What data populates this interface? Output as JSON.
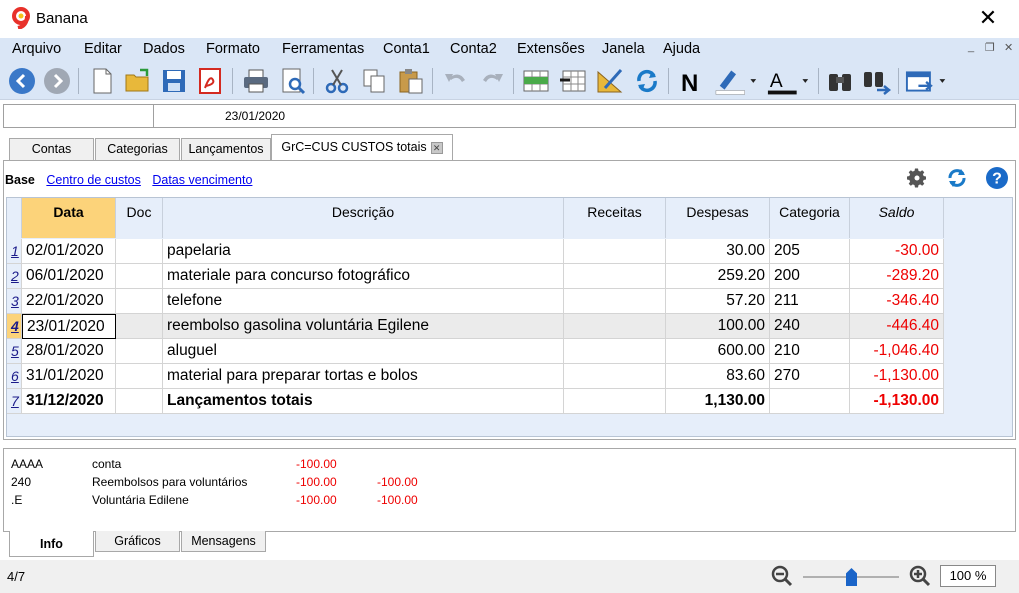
{
  "window": {
    "title": "Banana"
  },
  "menu": [
    "Arquivo",
    "Editar",
    "Dados",
    "Formato",
    "Ferramentas",
    "Conta1",
    "Conta2",
    "Extensões",
    "Janela",
    "Ajuda"
  ],
  "fieldbar": {
    "value": "23/01/2020"
  },
  "tabs": [
    "Contas",
    "Categorias",
    "Lançamentos",
    "GrC=CUS CUSTOS totais"
  ],
  "views": {
    "base": "Base",
    "cost_centers": "Centro de custos",
    "due_dates": "Datas vencimento"
  },
  "table": {
    "headers": {
      "date": "Data",
      "doc": "Doc",
      "description": "Descrição",
      "income": "Receitas",
      "expenses": "Despesas",
      "category": "Categoria",
      "balance": "Saldo"
    },
    "rows": [
      {
        "n": "1",
        "date": "02/01/2020",
        "doc": "",
        "description": "papelaria",
        "income": "",
        "expenses": "30.00",
        "category": "205",
        "balance": "-30.00"
      },
      {
        "n": "2",
        "date": "06/01/2020",
        "doc": "",
        "description": "materiale para concurso fotográfico",
        "income": "",
        "expenses": "259.20",
        "category": "200",
        "balance": "-289.20"
      },
      {
        "n": "3",
        "date": "22/01/2020",
        "doc": "",
        "description": "telefone",
        "income": "",
        "expenses": "57.20",
        "category": "211",
        "balance": "-346.40"
      },
      {
        "n": "4",
        "date": "23/01/2020",
        "doc": "",
        "description": "reembolso gasolina voluntária Egilene",
        "income": "",
        "expenses": "100.00",
        "category": "240",
        "balance": "-446.40"
      },
      {
        "n": "5",
        "date": "28/01/2020",
        "doc": "",
        "description": "aluguel",
        "income": "",
        "expenses": "600.00",
        "category": "210",
        "balance": "-1,046.40"
      },
      {
        "n": "6",
        "date": "31/01/2020",
        "doc": "",
        "description": "material para preparar tortas e bolos",
        "income": "",
        "expenses": "83.60",
        "category": "270",
        "balance": "-1,130.00"
      },
      {
        "n": "7",
        "date": "31/12/2020",
        "doc": "",
        "description": "Lançamentos totais",
        "income": "",
        "expenses": "1,130.00",
        "category": "",
        "balance": "-1,130.00"
      }
    ]
  },
  "info": [
    {
      "code": "AAAA",
      "label": "conta",
      "v1": "-100.00",
      "v2": ""
    },
    {
      "code": "240",
      "label": "Reembolsos para voluntários",
      "v1": "-100.00",
      "v2": "-100.00"
    },
    {
      "code": ".E",
      "label": "Voluntária Edilene",
      "v1": "-100.00",
      "v2": "-100.00"
    }
  ],
  "bottom_tabs": [
    "Info",
    "Gráficos",
    "Mensagens"
  ],
  "status": {
    "position": "4/7",
    "zoom": "100 %"
  },
  "colors": {
    "menubar": "#dae6f6",
    "header_active": "#fcd37a",
    "negative": "#ee0000",
    "link": "#0000ee"
  }
}
